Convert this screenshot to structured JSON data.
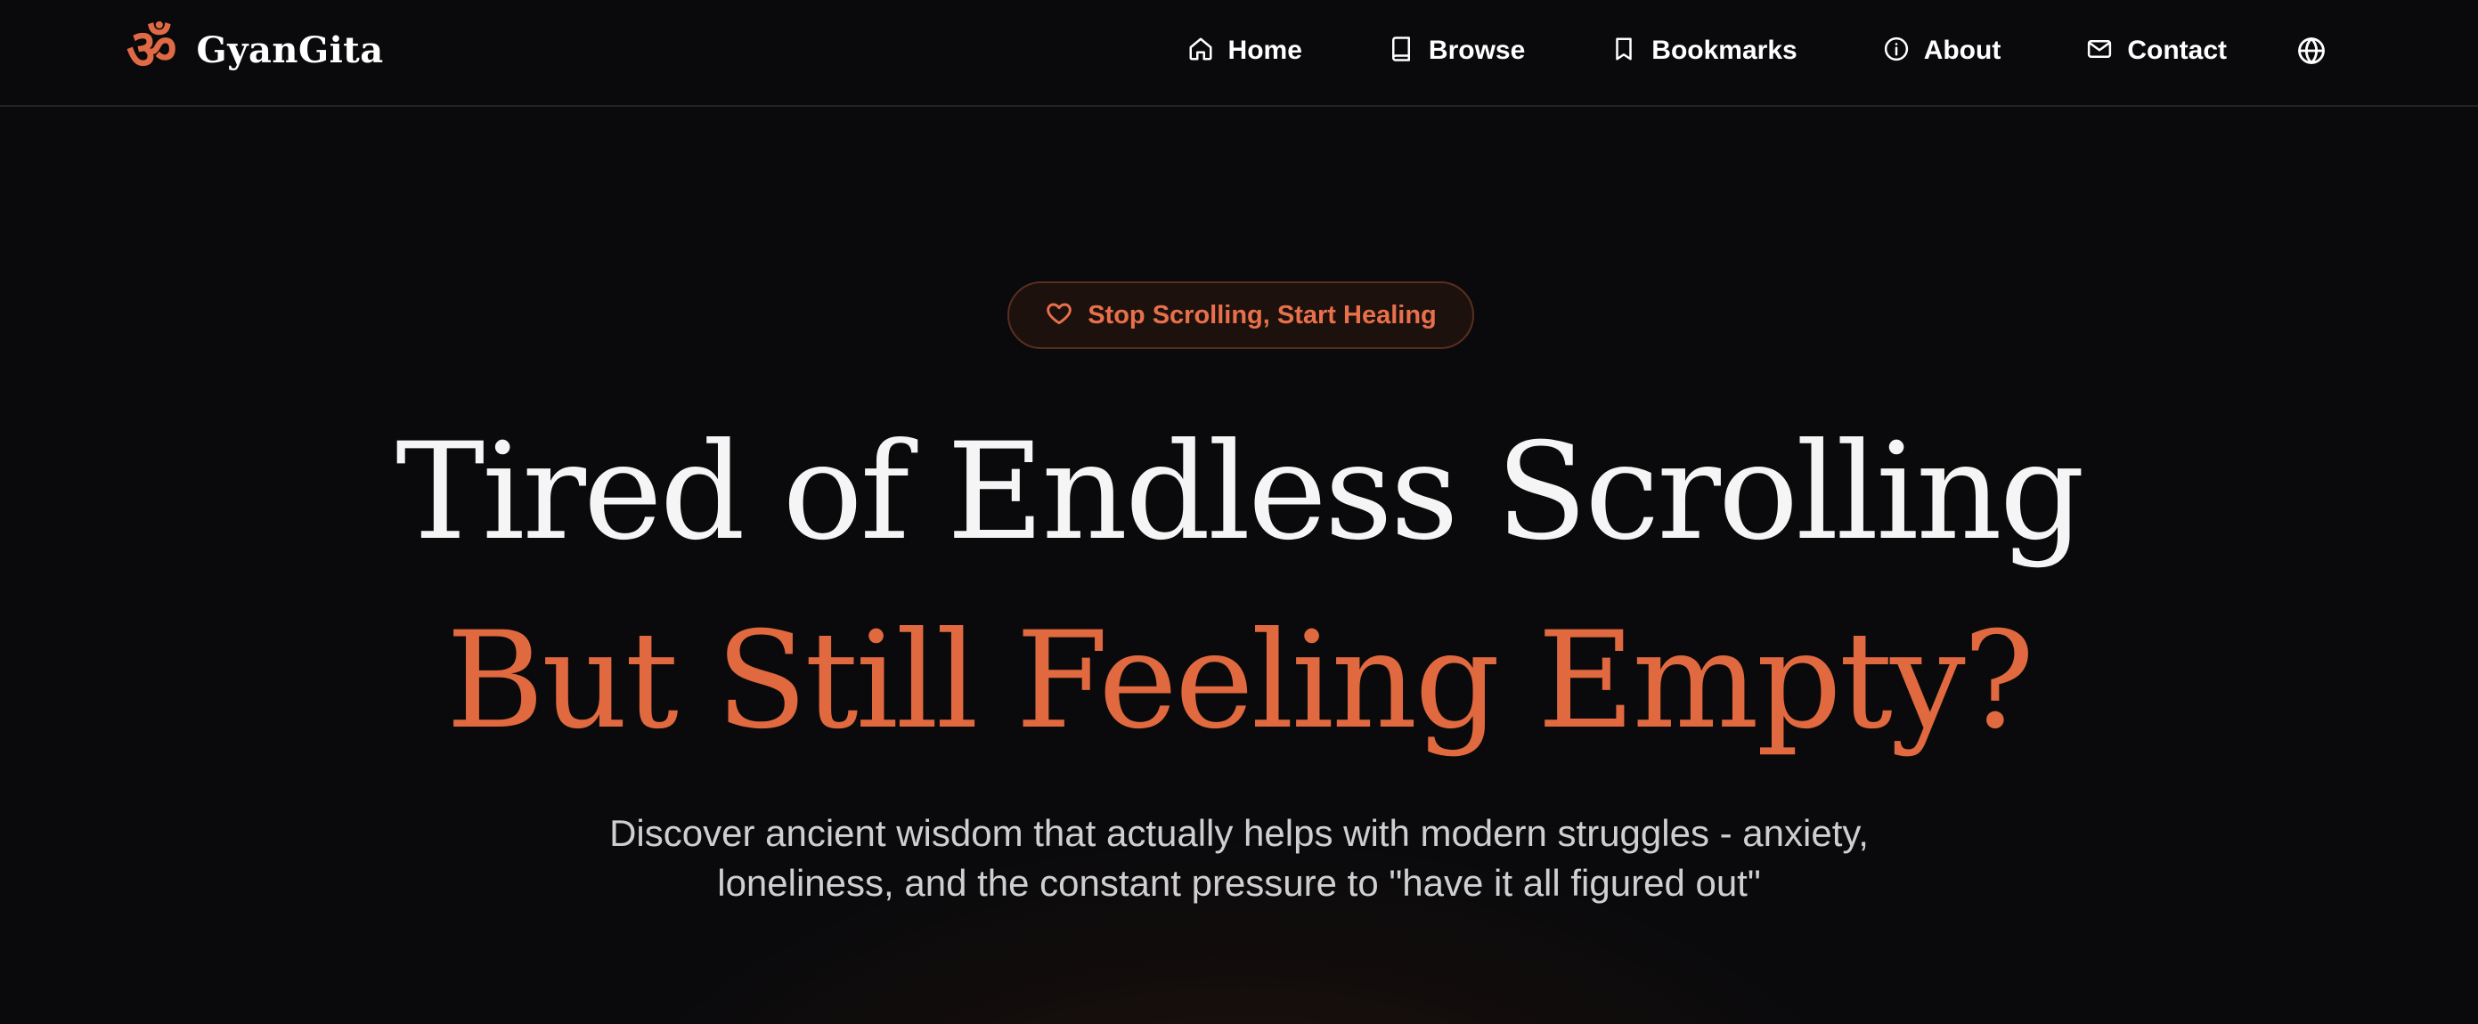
{
  "brand": {
    "mark": "ॐ",
    "name": "GyanGita",
    "accent_color": "#e0693f"
  },
  "nav": {
    "items": [
      {
        "label": "Home",
        "icon": "home-icon"
      },
      {
        "label": "Browse",
        "icon": "book-icon"
      },
      {
        "label": "Bookmarks",
        "icon": "bookmark-icon"
      },
      {
        "label": "About",
        "icon": "info-icon"
      },
      {
        "label": "Contact",
        "icon": "mail-icon"
      }
    ],
    "language_icon": "globe-icon"
  },
  "hero": {
    "badge": {
      "label": "Stop Scrolling, Start Healing",
      "icon": "heart-icon"
    },
    "headline_line1": "Tired of Endless Scrolling",
    "headline_line2": "But Still Feeling Empty?",
    "subtitle_line1": "Discover ancient wisdom that actually helps with modern struggles - anxiety,",
    "subtitle_line2": "loneliness, and the constant pressure to \"have it all figured out\""
  },
  "colors": {
    "background": "#0a0a0c",
    "text": "#f5f5f5",
    "accent": "#e0693f",
    "muted_text": "#cfcfd2"
  }
}
